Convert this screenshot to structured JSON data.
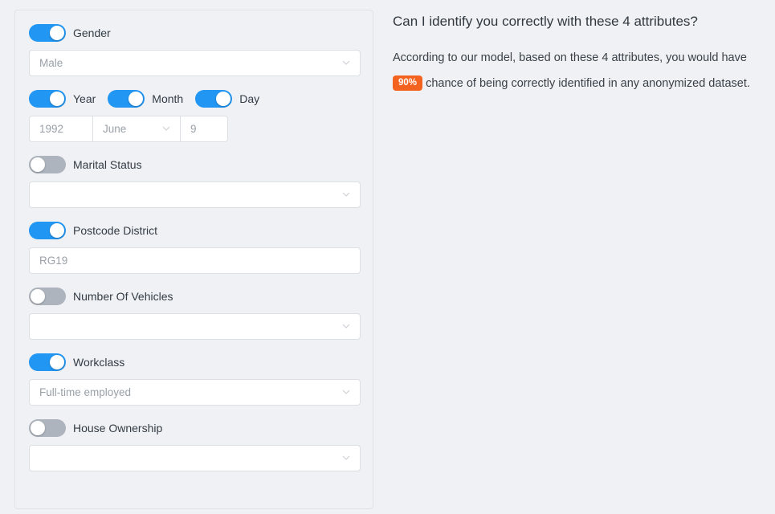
{
  "theme": {
    "page_background": "#eff1f4",
    "panel_border": "#dfe2e6",
    "toggle_on_color": "#2196f3",
    "toggle_off_color": "#aeb4bd",
    "badge_color": "#f4621f",
    "field_text_color": "#9aa0a8",
    "label_color": "#333b45"
  },
  "form": {
    "groups": [
      {
        "id": "gender",
        "toggles": [
          {
            "label": "Gender",
            "on": true
          }
        ],
        "control": {
          "type": "select",
          "value": "Male",
          "placeholder": "",
          "width": "full"
        }
      },
      {
        "id": "date-of-birth",
        "toggles": [
          {
            "label": "Year",
            "on": true
          },
          {
            "label": "Month",
            "on": true
          },
          {
            "label": "Day",
            "on": true
          }
        ],
        "date_controls": [
          {
            "id": "year",
            "type": "text",
            "value": "1992"
          },
          {
            "id": "month",
            "type": "select",
            "value": "June"
          },
          {
            "id": "day",
            "type": "text",
            "value": "9"
          }
        ]
      },
      {
        "id": "marital-status",
        "toggles": [
          {
            "label": "Marital Status",
            "on": false
          }
        ],
        "control": {
          "type": "select",
          "value": "",
          "placeholder": "",
          "width": "full"
        }
      },
      {
        "id": "postcode-district",
        "toggles": [
          {
            "label": "Postcode District",
            "on": true
          }
        ],
        "control": {
          "type": "text",
          "value": "RG19",
          "placeholder": "",
          "width": "full"
        }
      },
      {
        "id": "number-of-vehicles",
        "toggles": [
          {
            "label": "Number Of Vehicles",
            "on": false
          }
        ],
        "control": {
          "type": "select",
          "value": "",
          "placeholder": "",
          "width": "full"
        }
      },
      {
        "id": "workclass",
        "toggles": [
          {
            "label": "Workclass",
            "on": true
          }
        ],
        "control": {
          "type": "select",
          "value": "Full-time employed",
          "placeholder": "",
          "width": "full"
        }
      },
      {
        "id": "house-ownership",
        "toggles": [
          {
            "label": "House Ownership",
            "on": false
          }
        ],
        "control": {
          "type": "select",
          "value": "",
          "placeholder": "",
          "width": "full"
        }
      }
    ]
  },
  "info": {
    "heading": "Can I identify you correctly with these 4 attributes?",
    "body_before": "According to our model, based on these 4 attributes, you would have",
    "badge": "90%",
    "body_after": "chance of being correctly identified in any anonymized dataset."
  }
}
